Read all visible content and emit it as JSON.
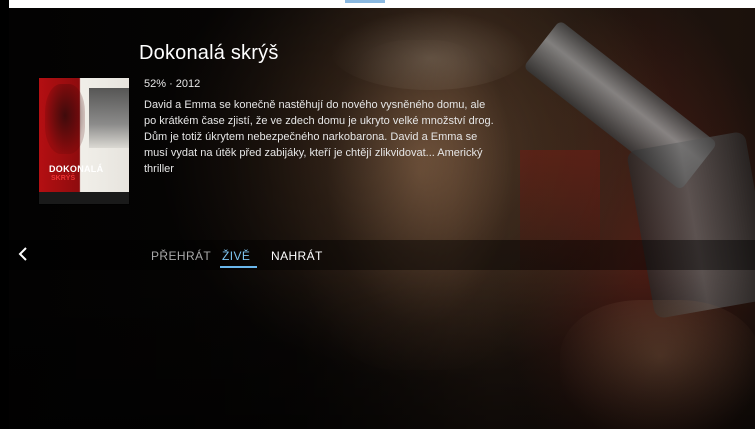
{
  "movie": {
    "title": "Dokonalá skrýš",
    "meta": "52% · 2012",
    "description": "David a Emma se konečně nastěhují do nového vysněného domu, ale po krátkém čase zjistí, že ve zdech domu je ukryto velké množství drog. Dům je totiž úkrytem nebezpečného narkobarona. David a Emma se musí vydat na útěk před zabijáky, kteří je chtějí zlikvidovat... Americký thriller",
    "poster": {
      "title_line1": "DOKONALÁ",
      "title_line2": "SKRÝŠ"
    }
  },
  "nav": {
    "back_icon": "chevron-left-icon",
    "tabs": [
      {
        "label": "PŘEHRÁT",
        "active": false
      },
      {
        "label": "ŽIVĚ",
        "active": true
      },
      {
        "label": "NAHRÁT",
        "active": false
      }
    ]
  },
  "colors": {
    "accent": "#6ab7ec",
    "text_primary": "#ffffff",
    "text_inactive": "#a9a9a9"
  }
}
